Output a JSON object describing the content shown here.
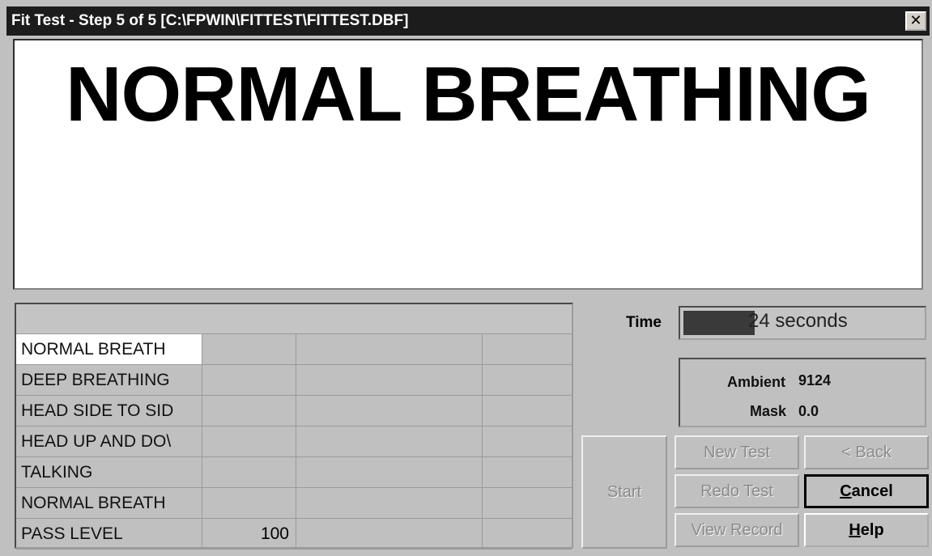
{
  "window": {
    "title": "Fit Test - Step 5 of 5 [C:\\FPWIN\\FITTEST\\FITTEST.DBF]",
    "close_symbol": "✕"
  },
  "instruction": {
    "text": "NORMAL BREATHING"
  },
  "exercises": [
    {
      "label": "NORMAL BREATH",
      "value": ""
    },
    {
      "label": "DEEP BREATHING",
      "value": ""
    },
    {
      "label": "HEAD SIDE TO SID",
      "value": ""
    },
    {
      "label": "HEAD UP AND DO\\",
      "value": ""
    },
    {
      "label": "TALKING",
      "value": ""
    },
    {
      "label": "NORMAL BREATH",
      "value": ""
    },
    {
      "label": "PASS LEVEL",
      "value": "100"
    }
  ],
  "status": {
    "time_label": "Time",
    "time_value": "24 seconds",
    "ambient_label": "Ambient",
    "ambient_value": "9124",
    "mask_label": "Mask",
    "mask_value": "0.0"
  },
  "buttons": {
    "start": "Start",
    "new_test": "New Test",
    "back": "< Back",
    "redo_test": "Redo Test",
    "cancel_first": "C",
    "cancel_rest": "ancel",
    "view_record": "View Record",
    "help_first": "H",
    "help_rest": "elp"
  }
}
